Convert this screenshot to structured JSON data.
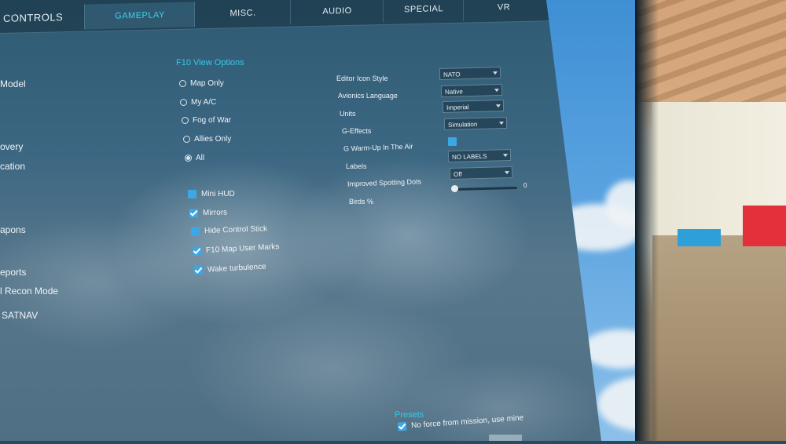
{
  "tabs": [
    {
      "label": "CONTROLS"
    },
    {
      "label": "GAMEPLAY"
    },
    {
      "label": "MISC."
    },
    {
      "label": "AUDIO"
    },
    {
      "label": "SPECIAL"
    },
    {
      "label": "VR"
    }
  ],
  "left_list": [
    {
      "label": "Model"
    },
    {
      "label": "overy"
    },
    {
      "label": "cation"
    },
    {
      "label": "apons"
    },
    {
      "label": "eports"
    },
    {
      "label": "l Recon Mode"
    },
    {
      "label": "SATNAV"
    }
  ],
  "f10": {
    "title": "F10 View Options",
    "options": [
      {
        "label": "Map Only",
        "selected": false
      },
      {
        "label": "My A/C",
        "selected": false
      },
      {
        "label": "Fog of War",
        "selected": false
      },
      {
        "label": "Allies Only",
        "selected": false
      },
      {
        "label": "All",
        "selected": true
      }
    ]
  },
  "checkboxes": [
    {
      "label": "Mini HUD",
      "checked": false
    },
    {
      "label": "Mirrors",
      "checked": true
    },
    {
      "label": "Hide Control Stick",
      "checked": false
    },
    {
      "label": "F10 Map User Marks",
      "checked": true
    },
    {
      "label": "Wake turbulence",
      "checked": true
    }
  ],
  "options": {
    "editor_icon_style": {
      "label": "Editor Icon Style",
      "value": "NATO"
    },
    "avionics_language": {
      "label": "Avionics Language",
      "value": "Native"
    },
    "units": {
      "label": "Units",
      "value": "Imperial"
    },
    "g_effects": {
      "label": "G-Effects",
      "value": "Simulation"
    },
    "g_warmup": {
      "label": "G Warm-Up In The Air",
      "checked": false
    },
    "labels": {
      "label": "Labels",
      "value": "NO LABELS"
    },
    "spotting_dots": {
      "label": "Improved Spotting Dots",
      "value": "Off"
    },
    "birds": {
      "label": "Birds %",
      "value": "0",
      "fraction": 0
    }
  },
  "presets": {
    "title": "Presets",
    "option_label": "No force from mission, use mine",
    "checked": true
  },
  "colors": {
    "accent": "#37c8ea",
    "checkbox": "#3ca7e6",
    "panel": "#3c6782"
  }
}
